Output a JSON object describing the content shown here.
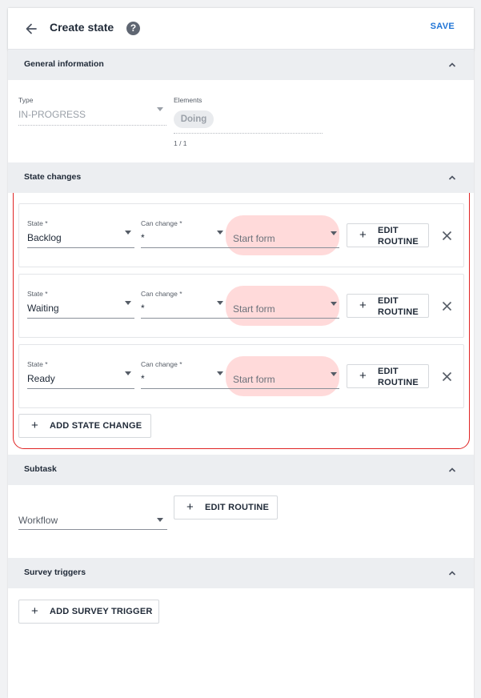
{
  "header": {
    "title": "Create state",
    "help_icon": "?",
    "save_label": "SAVE"
  },
  "general": {
    "title": "General information",
    "type_label": "Type",
    "type_value": "IN-PROGRESS",
    "elements_label": "Elements",
    "chip": "Doing",
    "counter": "1 / 1"
  },
  "state_changes": {
    "title": "State changes",
    "rows": [
      {
        "state_label": "State *",
        "state": "Backlog",
        "can_change_label": "Can change *",
        "can_change": "*",
        "form_placeholder": "Start form",
        "edit_label_1": "EDIT",
        "edit_label_2": "ROUTINE"
      },
      {
        "state_label": "State *",
        "state": "Waiting",
        "can_change_label": "Can change *",
        "can_change": "*",
        "form_placeholder": "Start form",
        "edit_label_1": "EDIT",
        "edit_label_2": "ROUTINE"
      },
      {
        "state_label": "State *",
        "state": "Ready",
        "can_change_label": "Can change *",
        "can_change": "*",
        "form_placeholder": "Start form",
        "edit_label_1": "EDIT",
        "edit_label_2": "ROUTINE"
      }
    ],
    "add_label": "ADD STATE CHANGE",
    "highlight_color": "#ffdada",
    "frame_color": "#e02424"
  },
  "subtask": {
    "title": "Subtask",
    "workflow": "Workflow",
    "edit_label": "EDIT ROUTINE"
  },
  "survey": {
    "title": "Survey triggers",
    "add_label": "ADD SURVEY TRIGGER"
  },
  "icons": {
    "back": "arrow-left-icon",
    "help": "question-circle-icon",
    "collapse": "chevron-up-icon",
    "remove": "close-icon",
    "add": "plus-icon",
    "dropdown": "caret-down-icon"
  },
  "colors": {
    "accent": "#1f74d6",
    "section_bg": "#eceef1"
  }
}
